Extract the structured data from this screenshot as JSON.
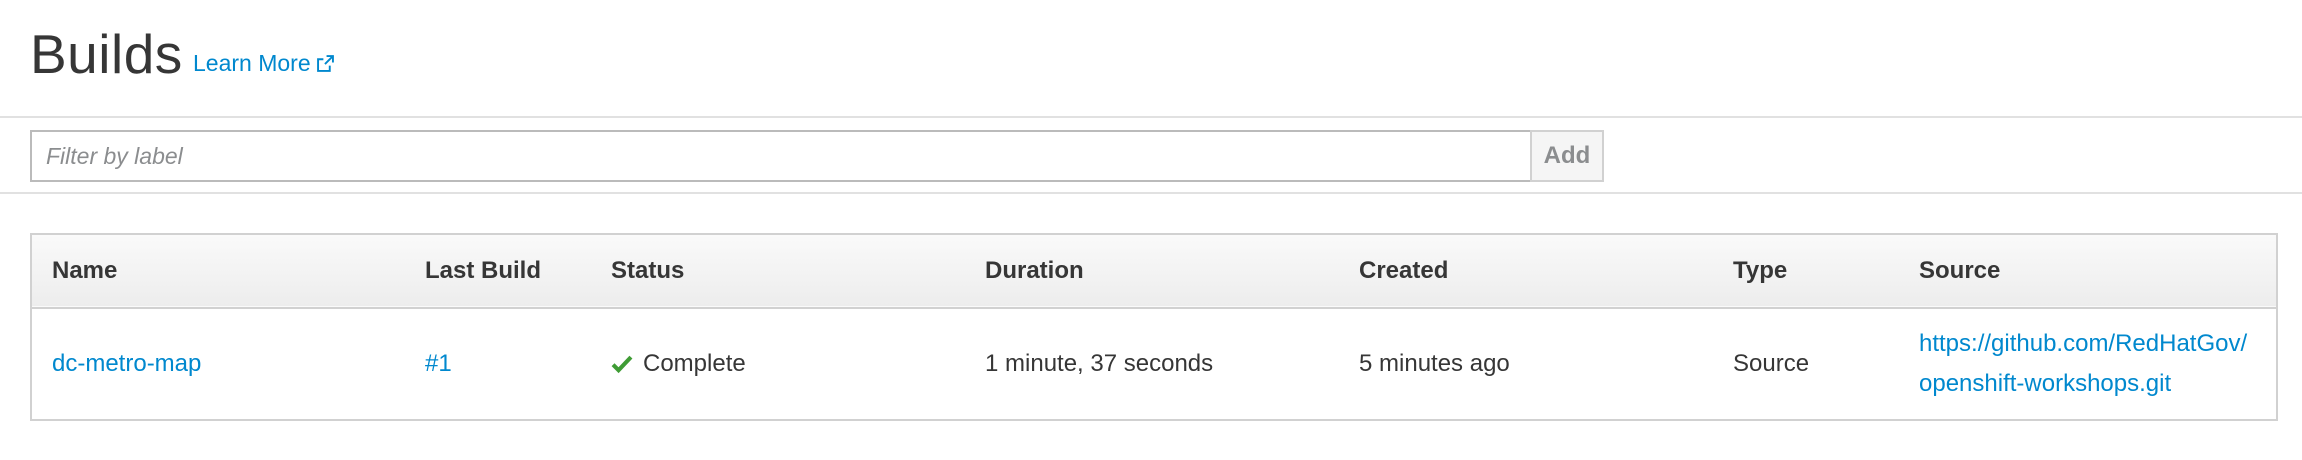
{
  "header": {
    "title": "Builds",
    "learn_more": "Learn More"
  },
  "filter": {
    "placeholder": "Filter by label",
    "value": "",
    "add_label": "Add"
  },
  "table": {
    "columns": [
      "Name",
      "Last Build",
      "Status",
      "Duration",
      "Created",
      "Type",
      "Source"
    ],
    "rows": [
      {
        "name": "dc-metro-map",
        "last_build": "#1",
        "status": "Complete",
        "status_icon": "check-icon",
        "duration": "1 minute, 37 seconds",
        "created": "5 minutes ago",
        "type": "Source",
        "source": "https://github.com/RedHatGov/openshift-workshops.git"
      }
    ]
  },
  "colors": {
    "link": "#0088ce",
    "success": "#3f9c35",
    "text": "#363636",
    "border": "#d1d1d1"
  }
}
